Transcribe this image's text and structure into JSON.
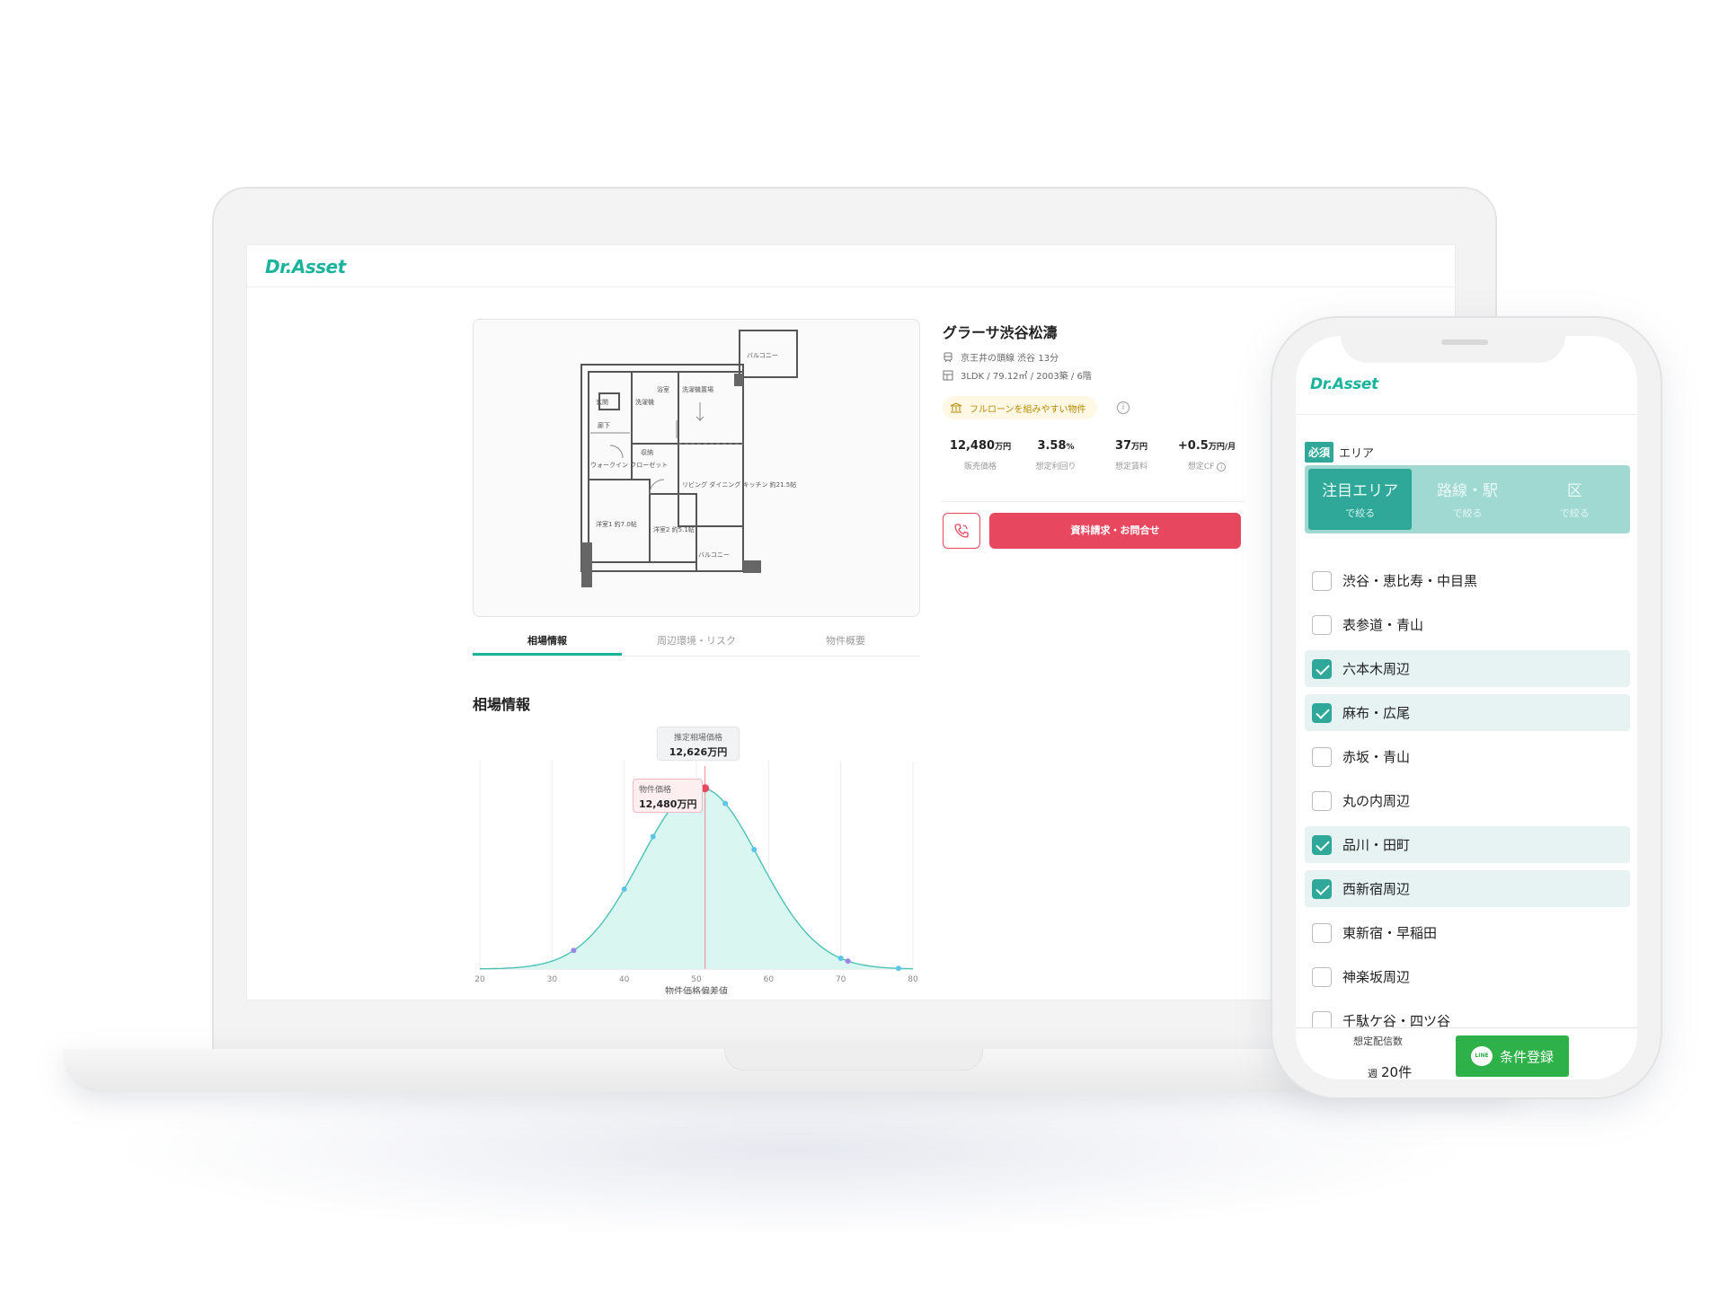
{
  "brand": "Dr.Asset",
  "colors": {
    "accent": "#1bb39c",
    "cta": "#e8485f",
    "teal_dark": "#2fa89a",
    "line_green": "#2fb14a"
  },
  "floorplan": {
    "labels": [
      "バルコニー",
      "玄関",
      "洗濯機",
      "浴室",
      "廊下",
      "収納",
      "ウォークイン クローゼット",
      "洋室1 約7.0帖",
      "洋室2 約5.1帖",
      "リビング ダイニング キッチン 約21.5帖",
      "洗濯機置場",
      "バルコニー"
    ]
  },
  "tabs": [
    "相場情報",
    "周辺環境・リスク",
    "物件概要"
  ],
  "section_title": "相場情報",
  "chart_data": {
    "type": "area",
    "xlabel": "物件価格偏差値",
    "x_ticks": [
      20,
      30,
      40,
      50,
      60,
      70,
      80
    ],
    "xlim": [
      20,
      80
    ],
    "series": [
      {
        "x": [
          20,
          33,
          40,
          44,
          51,
          54,
          58,
          70,
          71,
          78,
          80
        ],
        "y": [
          0.01,
          0.24,
          0.64,
          0.9,
          1.0,
          0.97,
          0.81,
          0.14,
          0.1,
          0.01,
          0.0
        ]
      }
    ],
    "markers": [
      {
        "x": 33,
        "color": "#9b87e8"
      },
      {
        "x": 40,
        "color": "#5cc6e8"
      },
      {
        "x": 44,
        "color": "#5cc6e8"
      },
      {
        "x": 51.2,
        "color": "#e8485f"
      },
      {
        "x": 54,
        "color": "#5cc6e8"
      },
      {
        "x": 58,
        "color": "#5cc6e8"
      },
      {
        "x": 70,
        "color": "#5cc6e8"
      },
      {
        "x": 71,
        "color": "#9b87e8"
      },
      {
        "x": 78,
        "color": "#5cc6e8"
      }
    ],
    "reference_line_x": 51.2,
    "estimated": {
      "label": "推定相場価格",
      "value": "12,626万円"
    },
    "property": {
      "label": "物件価格",
      "value": "12,480万円"
    },
    "grid": "vertical"
  },
  "property": {
    "name": "グラーサ渋谷松濤",
    "station": "京王井の頭線 渋谷 13分",
    "spec": "3LDK / 79.12㎡ / 2003築 / 6階",
    "loan_badge": "フルローンを組みやすい物件",
    "stats": [
      {
        "value": "12,480",
        "unit": "万円",
        "label": "販売価格"
      },
      {
        "value": "3.58",
        "unit": "%",
        "label": "想定利回り"
      },
      {
        "value": "37",
        "unit": "万円",
        "label": "想定賃料"
      },
      {
        "value": "+0.5",
        "unit": "万円/月",
        "label": "想定CF"
      }
    ],
    "inquiry_button": "資料請求・お問合せ"
  },
  "phone": {
    "required_badge": "必須",
    "required_label": "エリア",
    "segments": [
      {
        "title": "注目エリア",
        "sub": "で絞る",
        "active": true
      },
      {
        "title": "路線・駅",
        "sub": "で絞る",
        "active": false
      },
      {
        "title": "区",
        "sub": "で絞る",
        "active": false
      }
    ],
    "areas": [
      {
        "label": "渋谷・恵比寿・中目黒",
        "checked": false
      },
      {
        "label": "表参道・青山",
        "checked": false
      },
      {
        "label": "六本木周辺",
        "checked": true
      },
      {
        "label": "麻布・広尾",
        "checked": true
      },
      {
        "label": "赤坂・青山",
        "checked": false
      },
      {
        "label": "丸の内周辺",
        "checked": false
      },
      {
        "label": "品川・田町",
        "checked": true
      },
      {
        "label": "西新宿周辺",
        "checked": true
      },
      {
        "label": "東新宿・早稲田",
        "checked": false
      },
      {
        "label": "神楽坂周辺",
        "checked": false
      },
      {
        "label": "千駄ケ谷・四ツ谷",
        "checked": false
      }
    ],
    "footer": {
      "estimate_label": "想定配信数",
      "estimate_prefix": "週",
      "estimate_value": "20件",
      "line_icon_text": "LINE",
      "register_button": "条件登録"
    }
  }
}
